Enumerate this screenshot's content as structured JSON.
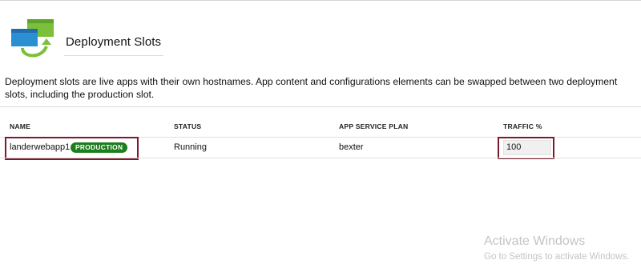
{
  "header": {
    "title": "Deployment Slots",
    "icon": "deployment-slots-icon"
  },
  "description": "Deployment slots are live apps with their own hostnames. App content and configurations elements can be swapped between two deployment slots, including the production slot.",
  "table": {
    "columns": [
      "NAME",
      "STATUS",
      "APP SERVICE PLAN",
      "TRAFFIC %"
    ],
    "rows": [
      {
        "name": "landerwebapp1",
        "badge": "PRODUCTION",
        "status": "Running",
        "plan": "bexter",
        "traffic": "100"
      }
    ]
  },
  "watermark": {
    "line1": "Activate Windows",
    "line2": "Go to Settings to activate Windows."
  },
  "colors": {
    "badge_bg": "#1e7e1e",
    "highlight_border": "#7a1a2a",
    "icon_blue": "#2b8fd4",
    "icon_green": "#7cbf3a"
  }
}
